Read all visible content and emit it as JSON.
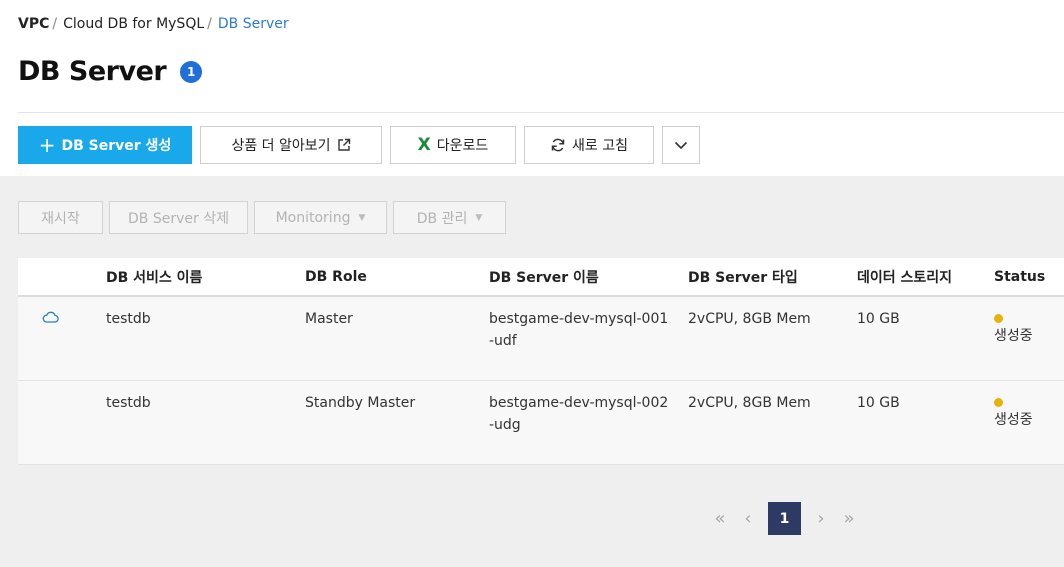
{
  "breadcrumb": {
    "items": [
      "VPC",
      "Cloud DB for MySQL",
      "DB Server"
    ],
    "separator": "/"
  },
  "page": {
    "title": "DB Server",
    "count": "1"
  },
  "toolbar": {
    "create_label": "DB Server 생성",
    "learn_label": "상품 더 알아보기",
    "download_label": "다운로드",
    "refresh_label": "새로 고침"
  },
  "actions": {
    "restart_label": "재시작",
    "delete_label": "DB Server 삭제",
    "monitoring_label": "Monitoring",
    "db_manage_label": "DB 관리"
  },
  "table": {
    "headers": {
      "service_name": "DB 서비스 이름",
      "role": "DB Role",
      "server_name": "DB Server 이름",
      "server_type": "DB Server 타입",
      "storage": "데이터 스토리지",
      "status": "Status"
    },
    "rows": [
      {
        "icon": "cloud-icon",
        "service_name": "testdb",
        "role": "Master",
        "server_name": "bestgame-dev-mysql-001-udf",
        "server_type": "2vCPU, 8GB Mem",
        "storage": "10 GB",
        "status": "생성중"
      },
      {
        "icon": "",
        "service_name": "testdb",
        "role": "Standby Master",
        "server_name": "bestgame-dev-mysql-002-udg",
        "server_type": "2vCPU, 8GB Mem",
        "storage": "10 GB",
        "status": "생성중"
      }
    ]
  },
  "pagination": {
    "current": "1"
  },
  "colors": {
    "primary": "#19a9ea",
    "badge": "#1e6fd9",
    "link": "#2e7bd6",
    "status_creating": "#e8b10c",
    "page_current": "#2d3a63"
  }
}
